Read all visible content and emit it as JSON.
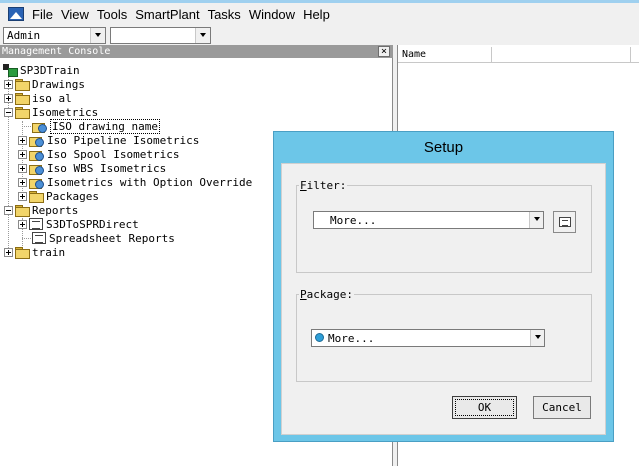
{
  "menu": {
    "items": [
      "File",
      "View",
      "Tools",
      "SmartPlant",
      "Tasks",
      "Window",
      "Help"
    ]
  },
  "toolbar": {
    "role_combo": "Admin",
    "second_combo": ""
  },
  "console": {
    "title": "Management Console",
    "close_glyph": "×",
    "tree": {
      "root": "SP3DTrain",
      "drawings": "Drawings",
      "iso_al": "iso al",
      "isometrics": "Isometrics",
      "iso_drawing_name": "ISO drawing name",
      "iso_pipeline": "Iso Pipeline Isometrics",
      "iso_spool": "Iso Spool Isometrics",
      "iso_wbs": "Iso WBS Isometrics",
      "iso_override": "Isometrics with Option Override",
      "packages": "Packages",
      "reports": "Reports",
      "s3d_to_spr": "S3DToSPRDirect",
      "spreadsheet": "Spreadsheet Reports",
      "train": "train"
    }
  },
  "list": {
    "column_name": "Name"
  },
  "dialog": {
    "title": "Setup",
    "filter": {
      "label_first": "F",
      "label_rest": "ilter:",
      "value": "More..."
    },
    "package": {
      "label_first": "P",
      "label_rest": "ackage:",
      "value": "More..."
    },
    "ok": "OK",
    "cancel": "Cancel"
  },
  "icons": {
    "app": "smartplant-app-icon",
    "folder": "folder-icon",
    "isometric": "isometric-drawing-icon",
    "report": "report-icon",
    "properties": "properties-icon",
    "package": "package-icon"
  },
  "colors": {
    "dialog_frame": "#6cc6e8",
    "console_title_bg": "#9a9a9a",
    "window_bg": "#f0f0f0"
  }
}
